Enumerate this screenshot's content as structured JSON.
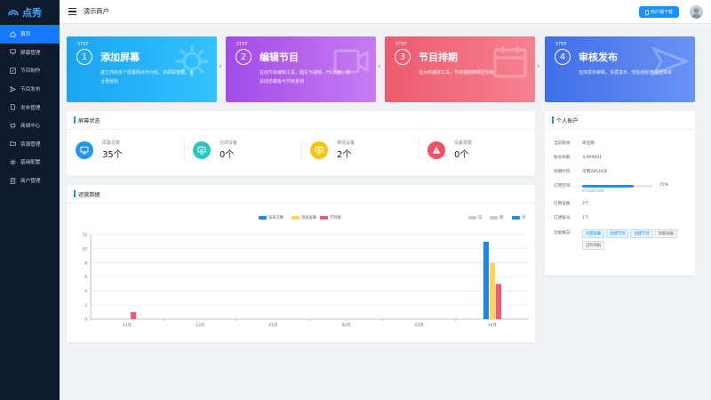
{
  "brand": {
    "name": "点秀",
    "color": "#3ea6ff"
  },
  "sidebar": {
    "items": [
      {
        "label": "首页",
        "icon": "home-icon",
        "active": true
      },
      {
        "label": "屏幕管理",
        "icon": "monitor-icon"
      },
      {
        "label": "节目制作",
        "icon": "edit-icon"
      },
      {
        "label": "节目发布",
        "icon": "send-icon"
      },
      {
        "label": "发布管理",
        "icon": "file-icon"
      },
      {
        "label": "商城中心",
        "icon": "shop-icon"
      },
      {
        "label": "资源管理",
        "icon": "folder-icon"
      },
      {
        "label": "基础配置",
        "icon": "gear-icon"
      },
      {
        "label": "商户管理",
        "icon": "document-icon"
      }
    ]
  },
  "header": {
    "title": "演示商户",
    "download_label": "商户端下载"
  },
  "steps": [
    {
      "label": "STEP",
      "num": "1",
      "title": "添加屏幕",
      "desc": "建立你的多个屏幕网点与分组、多屏联管理，企业更轻松"
    },
    {
      "label": "STEP",
      "num": "2",
      "title": "编辑节目",
      "desc": "在线节目编辑工具，图文与视频、H5页面，再是动态模板与节目素材"
    },
    {
      "label": "STEP",
      "num": "3",
      "title": "节目排期",
      "desc": "强大的编排工具，节目播放精细至秒级"
    },
    {
      "label": "STEP",
      "num": "4",
      "title": "审核发布",
      "desc": "支持发布审核，多屏发布、轻松组织管理更简单"
    }
  ],
  "screen_status": {
    "title": "屏幕状态",
    "items": [
      {
        "label": "屏幕总数",
        "value": "35个",
        "color": "#2196f3"
      },
      {
        "label": "在线设备",
        "value": "0个",
        "color": "#29c7bd"
      },
      {
        "label": "离线设备",
        "value": "2个",
        "color": "#f5c518"
      },
      {
        "label": "设备报警",
        "value": "0个",
        "color": "#ef5466"
      }
    ]
  },
  "ops": {
    "title": "运营数据"
  },
  "chart_data": {
    "type": "bar",
    "categories": [
      "11月",
      "12月",
      "01月",
      "02月",
      "03月",
      "04月"
    ],
    "series": [
      {
        "name": "发布次数",
        "color": "#1e88e5",
        "values": [
          0,
          0,
          0,
          0,
          0,
          11
        ]
      },
      {
        "name": "添加屏幕",
        "color": "#ffd54f",
        "values": [
          0,
          0,
          0,
          0,
          0,
          8
        ]
      },
      {
        "name": "节目数",
        "color": "#ef5b6f",
        "values": [
          1,
          0,
          0,
          0,
          0,
          5
        ]
      }
    ],
    "range_options": [
      {
        "label": "日",
        "selected": false
      },
      {
        "label": "周",
        "selected": false
      },
      {
        "label": "月",
        "selected": true
      }
    ],
    "ylim": [
      0,
      12
    ],
    "yticks": [
      "0",
      "2",
      "4",
      "6",
      "8",
      "10",
      "12"
    ],
    "grid": true,
    "legend_position": "top"
  },
  "account": {
    "title": "个人账户",
    "rows": [
      {
        "label": "当前版本:",
        "value": "商业版"
      },
      {
        "label": "账号余额:",
        "value": "￥999001"
      },
      {
        "label": "到期时间:",
        "value": "可用28544天"
      }
    ],
    "storage": {
      "label": "已用空间:",
      "percent": "72%",
      "fraction": 0.72,
      "detail": "672GB/1GB"
    },
    "rows2": [
      {
        "label": "已用设备:",
        "value": "2个"
      },
      {
        "label": "已建账号:",
        "value": "1个"
      }
    ],
    "shortcuts_label": "功能概况:",
    "shortcuts": [
      "创建屏幕",
      "创建节目",
      "创建节目",
      "效果海报",
      "自制海报"
    ]
  }
}
